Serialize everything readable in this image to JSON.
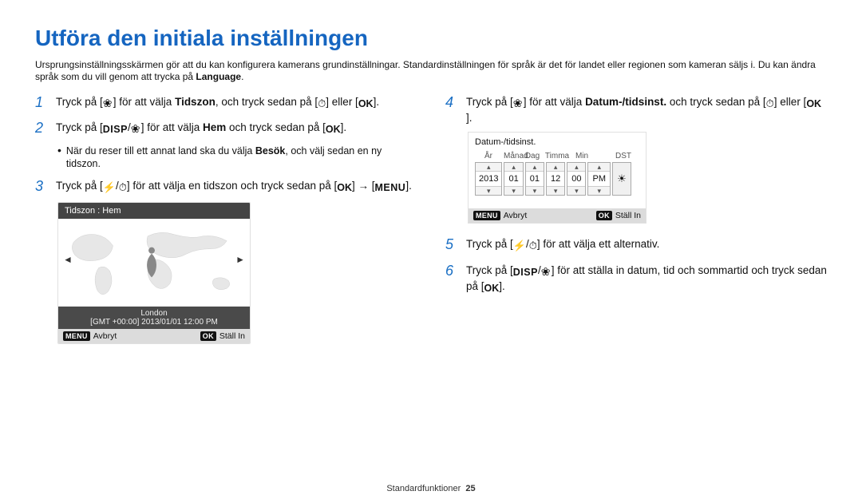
{
  "title": "Utföra den initiala inställningen",
  "intro_part1": "Ursprungsinställningsskärmen gör att du kan konfigurera kamerans grundinställningar. Standardinställningen för språk är det för landet eller regionen som kameran säljs i. Du kan ändra språk som du vill genom att trycka på ",
  "intro_strong": "Language",
  "intro_part2": ".",
  "labels": {
    "ok": "OK",
    "disp": "DISP",
    "menu": "MENU"
  },
  "steps": {
    "s1": {
      "num": "1",
      "a": "Tryck på [",
      "b": "] för att välja ",
      "strong": "Tidszon",
      "c": ", och tryck sedan på [",
      "d": "] eller [",
      "e": "]."
    },
    "s2": {
      "num": "2",
      "a": "Tryck på [",
      "b": "] för att välja ",
      "strong": "Hem",
      "c": " och tryck sedan på [",
      "d": "]."
    },
    "s2_bullet": {
      "a": "När du reser till ett annat land ska du välja ",
      "strong": "Besök",
      "b": ", och välj sedan en ny tidszon."
    },
    "s3": {
      "num": "3",
      "a": "Tryck på [",
      "b": "] för att välja en tidszon och tryck sedan på [",
      "c": "] → [",
      "d": "]."
    },
    "s4": {
      "num": "4",
      "a": "Tryck på [",
      "b": "] för att välja ",
      "strong": "Datum-/tidsinst.",
      "c": " och tryck sedan på [",
      "d": "] eller [",
      "e": "]."
    },
    "s5": {
      "num": "5",
      "a": "Tryck på [",
      "b": "] för att välja ett alternativ."
    },
    "s6": {
      "num": "6",
      "a": "Tryck på [",
      "b": "] för att ställa in datum, tid och sommartid och tryck sedan på [",
      "c": "]."
    }
  },
  "screen1": {
    "header": "Tidszon : Hem",
    "location": "London",
    "timestamp": "[GMT +00:00] 2013/01/01 12:00 PM",
    "footer_left": "Avbryt",
    "footer_left_tag": "MENU",
    "footer_right": "Ställ In",
    "footer_right_tag": "OK"
  },
  "screen2": {
    "header": "Datum-/tidsinst.",
    "cols": {
      "year": "År",
      "month": "Månad",
      "day": "Dag",
      "hour": "Timma",
      "min": "Min",
      "dst": "DST"
    },
    "vals": {
      "year": "2013",
      "month": "01",
      "day": "01",
      "hour": "12",
      "min": "00",
      "ampm": "PM"
    },
    "footer_left": "Avbryt",
    "footer_left_tag": "MENU",
    "footer_right": "Ställ In",
    "footer_right_tag": "OK"
  },
  "footer": {
    "section": "Standardfunktioner",
    "page": "25"
  }
}
